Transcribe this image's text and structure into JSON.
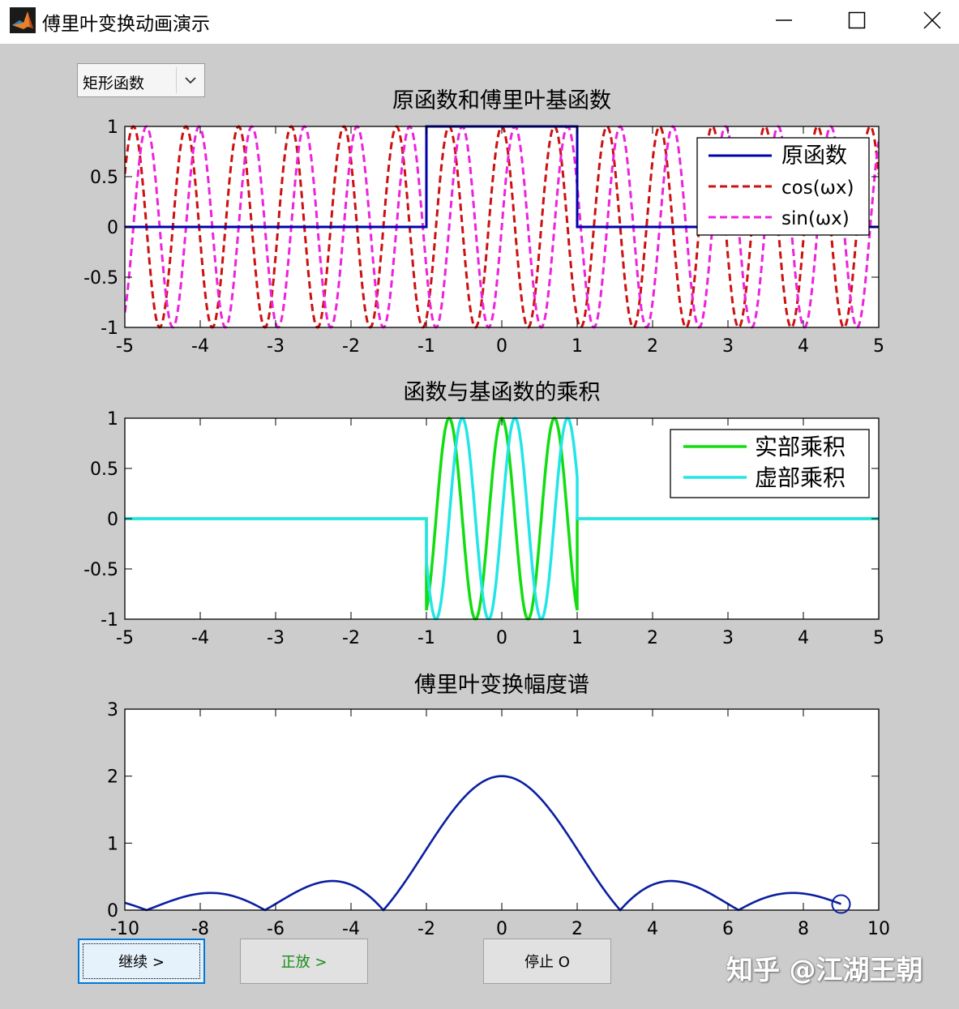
{
  "window": {
    "title": "傅里叶变换动画演示",
    "minimize_glyph": "─",
    "maximize_glyph": "☐",
    "close_glyph": "✕",
    "icon": "matlab-icon"
  },
  "dropdown": {
    "selected": "矩形函数",
    "icon": "chevron-down-icon"
  },
  "buttons": {
    "continue_label": "继续 >",
    "forward_label": "正放 >",
    "stop_label": "停止 O"
  },
  "watermark": "知乎 @江湖王朝",
  "colors": {
    "client_bg": "#cccccc",
    "original": "#0000aa",
    "cos": "#cc1111",
    "sin": "#ee22dd",
    "real": "#11dd11",
    "imag": "#22e6e6",
    "spectrum": "#0a1fa0"
  },
  "chart_data": [
    {
      "type": "line",
      "title": "原函数和傅里叶基函数",
      "xlim": [
        -5,
        5
      ],
      "ylim": [
        -1,
        1
      ],
      "xticks": [
        "-5",
        "-4",
        "-3",
        "-2",
        "-1",
        "0",
        "1",
        "2",
        "3",
        "4",
        "5"
      ],
      "yticks": [
        "-1",
        "-0.5",
        "0",
        "0.5",
        "1"
      ],
      "legend_position": "top-right",
      "omega": 9,
      "series": [
        {
          "name": "原函数",
          "style": "solid",
          "x": [
            -5,
            -1,
            -1,
            1,
            1,
            5
          ],
          "y": [
            0,
            0,
            1,
            1,
            0,
            0
          ]
        },
        {
          "name": "cos(ωx)",
          "style": "dashed",
          "function": "cos(9x)"
        },
        {
          "name": "sin(ωx)",
          "style": "dashed",
          "function": "sin(9x)"
        }
      ]
    },
    {
      "type": "line",
      "title": "函数与基函数的乘积",
      "xlim": [
        -5,
        5
      ],
      "ylim": [
        -1,
        1
      ],
      "xticks": [
        "-5",
        "-4",
        "-3",
        "-2",
        "-1",
        "0",
        "1",
        "2",
        "3",
        "4",
        "5"
      ],
      "yticks": [
        "-1",
        "-0.5",
        "0",
        "0.5",
        "1"
      ],
      "legend_position": "top-right",
      "series": [
        {
          "name": "实部乘积",
          "function": "rect(x)·cos(9x)"
        },
        {
          "name": "虚部乘积",
          "function": "rect(x)·sin(9x)"
        }
      ]
    },
    {
      "type": "line",
      "title": "傅里叶变换幅度谱",
      "xlim": [
        -10,
        10
      ],
      "ylim": [
        0,
        3
      ],
      "xticks": [
        "-10",
        "-8",
        "-6",
        "-4",
        "-2",
        "0",
        "2",
        "4",
        "6",
        "8",
        "10"
      ],
      "yticks": [
        "0",
        "1",
        "2",
        "3"
      ],
      "series": [
        {
          "function": "|2·sin(w)/w|",
          "x_range": [
            -10,
            9
          ]
        }
      ],
      "marker": {
        "shape": "circle",
        "x": 9,
        "y": 0.09
      }
    }
  ]
}
